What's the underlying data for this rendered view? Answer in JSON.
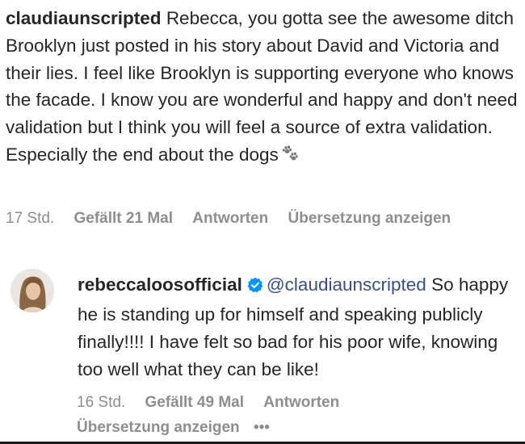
{
  "comment1": {
    "username": "claudiaunscripted",
    "text": "Rebecca, you gotta see the awesome ditch Brooklyn just posted in his story about David and Victoria and their lies. I feel like Brooklyn is supporting everyone who knows the facade. I know you are wonderful and happy and don't need validation but I think you will feel a source of extra validation. Especially the end about the dogs",
    "emoji_icon": "paw-prints-icon",
    "time": "17 Std.",
    "likes": "Gefällt 21 Mal",
    "reply": "Antworten",
    "translate": "Übersetzung anzeigen"
  },
  "comment2": {
    "username": "rebeccaloosofficial",
    "verified_icon": "verified-badge-icon",
    "mention": "@claudiaunscripted",
    "text": "So happy he is standing up for himself and speaking publicly finally!!!! I have felt so bad for his poor wife, knowing too well what they can be like!",
    "time": "16 Std.",
    "likes": "Gefällt 49 Mal",
    "reply": "Antworten",
    "translate": "Übersetzung anzeigen",
    "more": "•••"
  },
  "colors": {
    "text": "#262626",
    "meta": "#8e8e8e",
    "mention": "#385185",
    "verified": "#0095f6"
  }
}
